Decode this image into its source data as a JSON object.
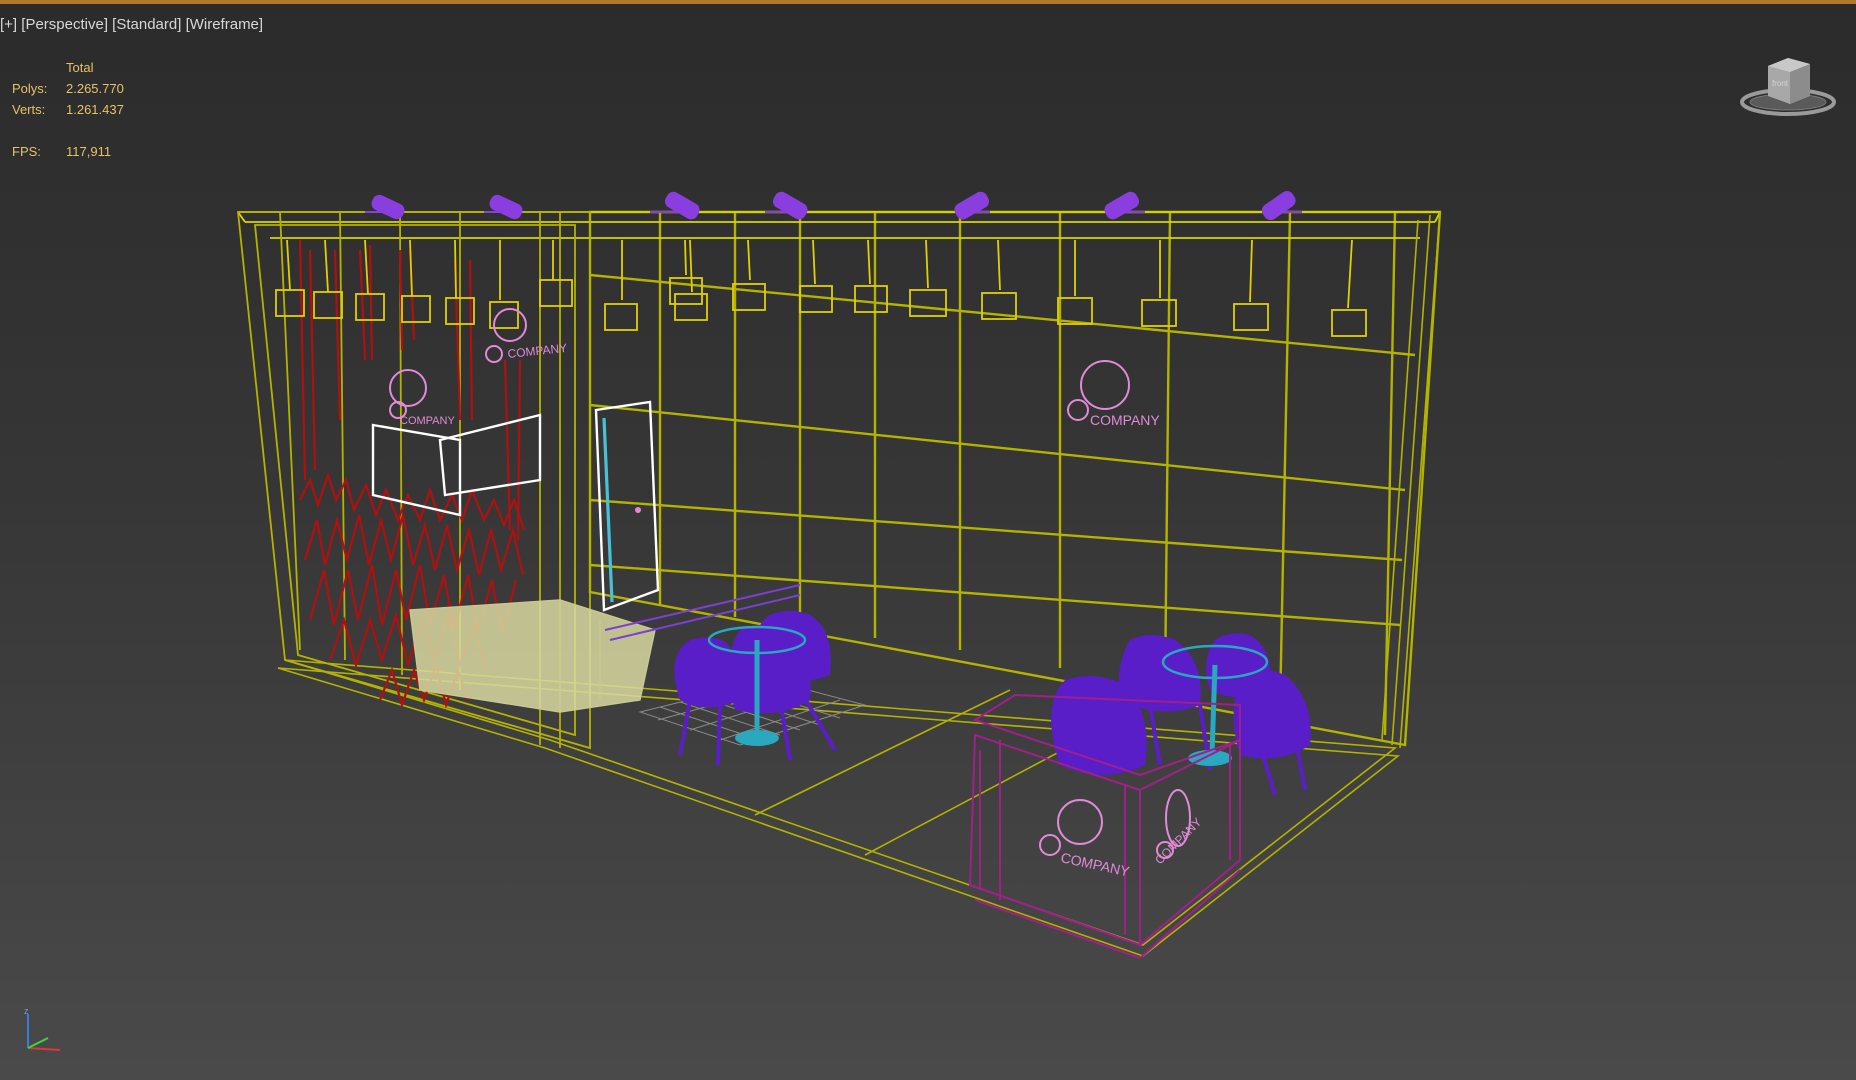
{
  "viewport": {
    "label_plus": "[+]",
    "label_view": "[Perspective]",
    "label_shading": "[Standard]",
    "label_mode": "[Wireframe]"
  },
  "stats": {
    "header": "Total",
    "polys_label": "Polys:",
    "polys_value": "2.265.770",
    "verts_label": "Verts:",
    "verts_value": "1.261.437",
    "fps_label": "FPS:",
    "fps_value": "117,911"
  },
  "scene": {
    "logo_text": "COMPANY",
    "colors": {
      "booth_frame": "#b3b300",
      "booth_frame_bright": "#d6d600",
      "lights": "#e0d000",
      "spotlights": "#8a3ee0",
      "chairs": "#5a1ec8",
      "tables": "#2aa8c0",
      "plant_wall": "#b01010",
      "logo": "#e08ad8",
      "counter": "#a0208a",
      "door": "#4ac0d8",
      "screen": "#ffffff",
      "floor_grid": "#8a8a8a"
    }
  },
  "viewcube": {
    "face_label": "front",
    "icon": "viewcube-icon"
  },
  "axis": {
    "z_label": "z",
    "icon": "axis-tripod-icon"
  }
}
